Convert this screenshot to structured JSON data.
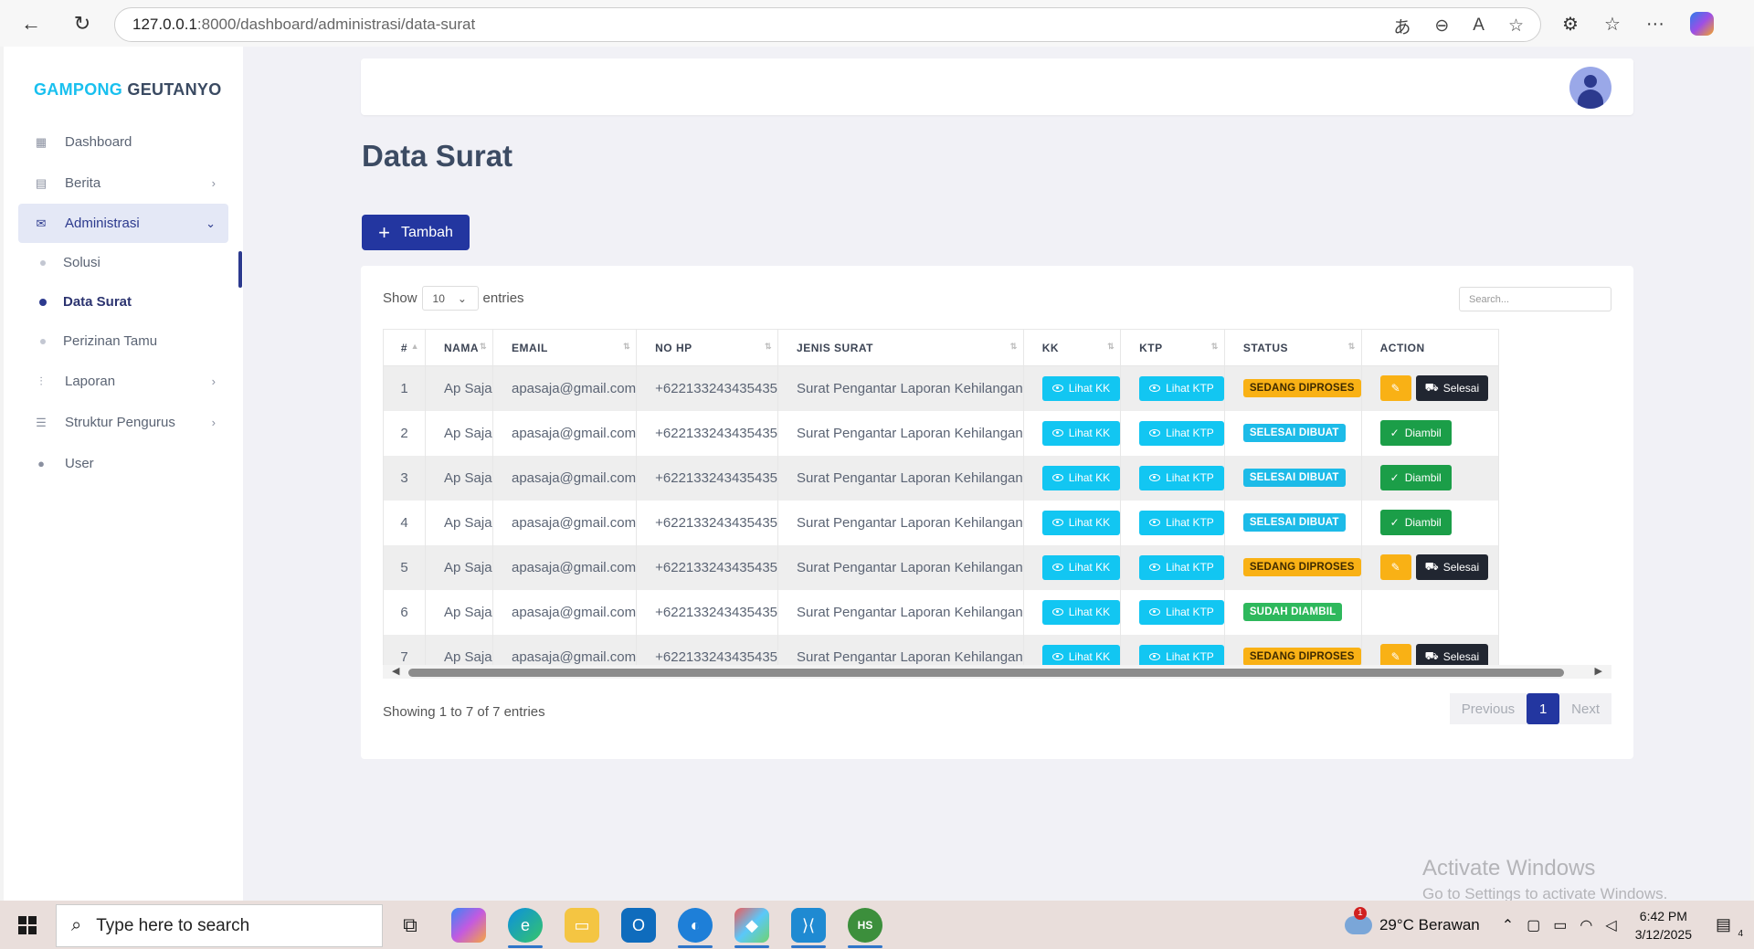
{
  "browser": {
    "url_host": "127.0.0.1",
    "url_rest": ":8000/dashboard/administrasi/data-surat"
  },
  "sidebar": {
    "brand_a": "GAMPONG",
    "brand_b": "GEUTANYO",
    "items": [
      {
        "label": "Dashboard"
      },
      {
        "label": "Berita"
      },
      {
        "label": "Administrasi"
      },
      {
        "label": "Laporan"
      },
      {
        "label": "Struktur Pengurus"
      },
      {
        "label": "User"
      }
    ],
    "sub_items": [
      {
        "label": "Solusi"
      },
      {
        "label": "Data Surat"
      },
      {
        "label": "Perizinan Tamu"
      }
    ]
  },
  "main": {
    "title": "Data Surat",
    "add_button": "Tambah",
    "show_label": "Show",
    "entries_label": "entries",
    "page_size": "10",
    "search_placeholder": "Search...",
    "columns": [
      "#",
      "NAMA",
      "EMAIL",
      "NO HP",
      "JENIS SURAT",
      "KK",
      "KTP",
      "STATUS",
      "ACTION"
    ],
    "kk_button": "Lihat KK",
    "ktp_button": "Lihat KTP",
    "rows": [
      {
        "no": "1",
        "nama": "Ap Saja",
        "email": "apasaja@gmail.com",
        "hp": "+622133243435435",
        "jenis": "Surat Pengantar Laporan Kehilangan",
        "status": "SEDANG DIPROSES",
        "action": "Selesai"
      },
      {
        "no": "2",
        "nama": "Ap Saja",
        "email": "apasaja@gmail.com",
        "hp": "+622133243435435",
        "jenis": "Surat Pengantar Laporan Kehilangan",
        "status": "SELESAI DIBUAT",
        "action": "Diambil"
      },
      {
        "no": "3",
        "nama": "Ap Saja",
        "email": "apasaja@gmail.com",
        "hp": "+622133243435435",
        "jenis": "Surat Pengantar Laporan Kehilangan",
        "status": "SELESAI DIBUAT",
        "action": "Diambil"
      },
      {
        "no": "4",
        "nama": "Ap Saja",
        "email": "apasaja@gmail.com",
        "hp": "+622133243435435",
        "jenis": "Surat Pengantar Laporan Kehilangan",
        "status": "SELESAI DIBUAT",
        "action": "Diambil"
      },
      {
        "no": "5",
        "nama": "Ap Saja",
        "email": "apasaja@gmail.com",
        "hp": "+622133243435435",
        "jenis": "Surat Pengantar Laporan Kehilangan",
        "status": "SEDANG DIPROSES",
        "action": "Selesai"
      },
      {
        "no": "6",
        "nama": "Ap Saja",
        "email": "apasaja@gmail.com",
        "hp": "+622133243435435",
        "jenis": "Surat Pengantar Laporan Kehilangan",
        "status": "SUDAH DIAMBIL",
        "action": ""
      },
      {
        "no": "7",
        "nama": "Ap Saja",
        "email": "apasaja@gmail.com",
        "hp": "+622133243435435",
        "jenis": "Surat Pengantar Laporan Kehilangan",
        "status": "SEDANG DIPROSES",
        "action": "Selesai"
      }
    ],
    "info": "Showing 1 to 7 of 7 entries",
    "pager": {
      "prev": "Previous",
      "current": "1",
      "next": "Next"
    }
  },
  "watermark": {
    "line1": "Activate Windows",
    "line2": "Go to Settings to activate Windows."
  },
  "taskbar": {
    "search_placeholder": "Type here to search",
    "weather": "29°C  Berawan",
    "weather_badge": "1",
    "time": "6:42 PM",
    "date": "3/12/2025",
    "notif_count": "4"
  },
  "colors": {
    "primary": "#2336a0",
    "cyan": "#12c6f2",
    "warning": "#f9b115",
    "success": "#2eb85c",
    "dark": "#212631"
  }
}
